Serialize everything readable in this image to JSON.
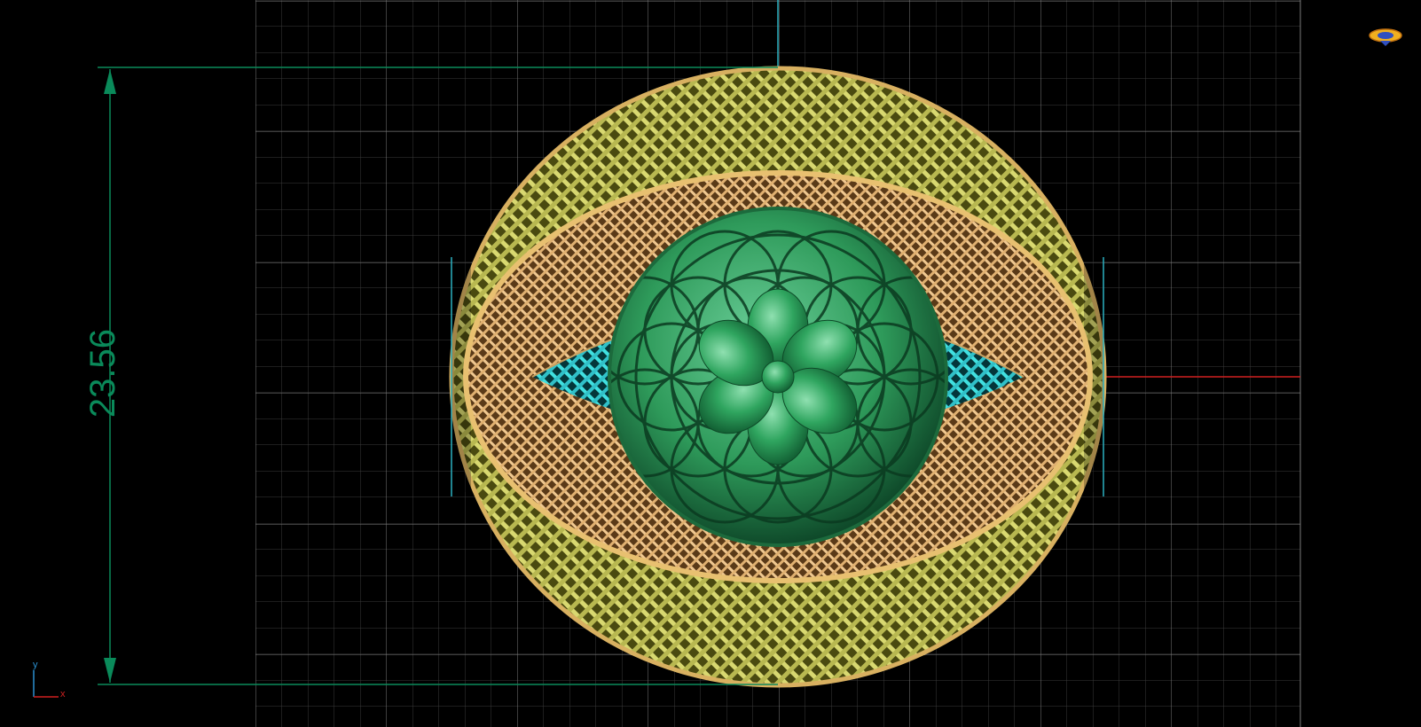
{
  "viewport": {
    "background": "#000000",
    "grid_color": "#7a7a7a",
    "minor_grid_color": "#3a3a3a"
  },
  "dimension": {
    "value": "23.56",
    "color": "#0a8a5a"
  },
  "axes": {
    "x_label": "x",
    "y_label": "y",
    "x_color": "#d02020",
    "y_color": "#2a8fd0"
  },
  "model": {
    "outer_band_color": "#c8c85a",
    "inner_mesh_color": "#e0b070",
    "inner_lattice_color": "#3fd0d0",
    "dome_color": "#2e9a5a",
    "flower_color": "#2fa55f"
  },
  "view_cube": {
    "icon": "view-orientation-icon"
  }
}
